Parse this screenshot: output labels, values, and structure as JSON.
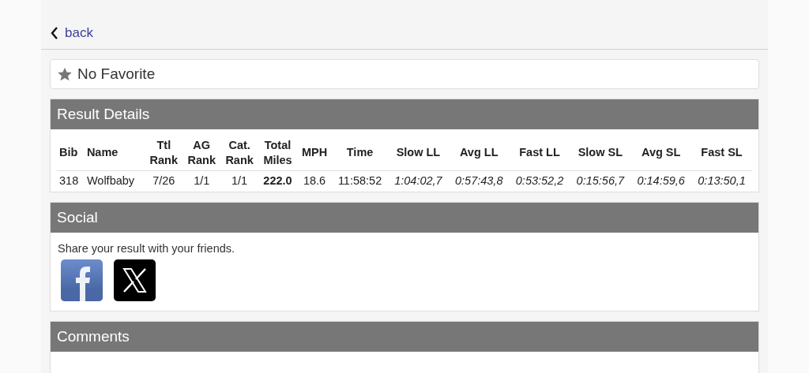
{
  "back_link": {
    "label": "back"
  },
  "favorite": {
    "label": "No Favorite",
    "on": false
  },
  "result_details": {
    "title": "Result Details",
    "columns": [
      "Bib",
      "Name",
      "Ttl Rank",
      "AG Rank",
      "Cat. Rank",
      "Total Miles",
      "MPH",
      "Time",
      "Slow LL",
      "Avg LL",
      "Fast LL",
      "Slow SL",
      "Avg SL",
      "Fast SL"
    ],
    "rows": [
      [
        "318",
        "Wolfbaby",
        "7/26",
        "1/1",
        "1/1",
        "222.0",
        "18.6",
        "11:58:52",
        "1:04:02,7",
        "0:57:43,8",
        "0:53:52,2",
        "0:15:56,7",
        "0:14:59,6",
        "0:13:50,1"
      ]
    ]
  },
  "social": {
    "title": "Social",
    "text": "Share your result with your friends.",
    "shares": [
      {
        "kind": "facebook"
      },
      {
        "kind": "x"
      }
    ]
  },
  "comments": {
    "title": "Comments"
  }
}
